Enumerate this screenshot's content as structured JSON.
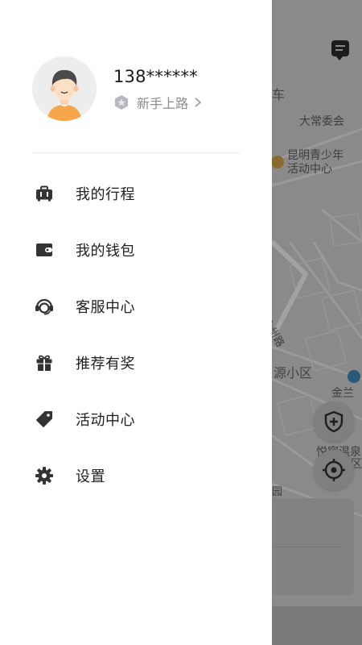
{
  "user": {
    "phone": "138******",
    "level_label": "新手上路"
  },
  "menu": {
    "items": [
      {
        "label": "我的行程",
        "icon": "luggage-icon"
      },
      {
        "label": "我的钱包",
        "icon": "wallet-icon"
      },
      {
        "label": "客服中心",
        "icon": "headset-icon"
      },
      {
        "label": "推荐有奖",
        "icon": "gift-icon"
      },
      {
        "label": "活动中心",
        "icon": "tag-icon"
      },
      {
        "label": "设置",
        "icon": "gear-icon"
      }
    ]
  },
  "map": {
    "labels": {
      "car": "车",
      "committee": "大常委会",
      "youth_center_line1": "昆明青少年",
      "youth_center_line2": "活动中心",
      "road": "金州路",
      "district": "源小区",
      "jinlan": "金兰",
      "spring_line1": "悦宸温泉",
      "spring_line2": "区",
      "park": "园"
    }
  },
  "colors": {
    "drawer_bg": "#ffffff",
    "overlay": "#8a8a8a",
    "icon_dark": "#3a3a3a"
  }
}
